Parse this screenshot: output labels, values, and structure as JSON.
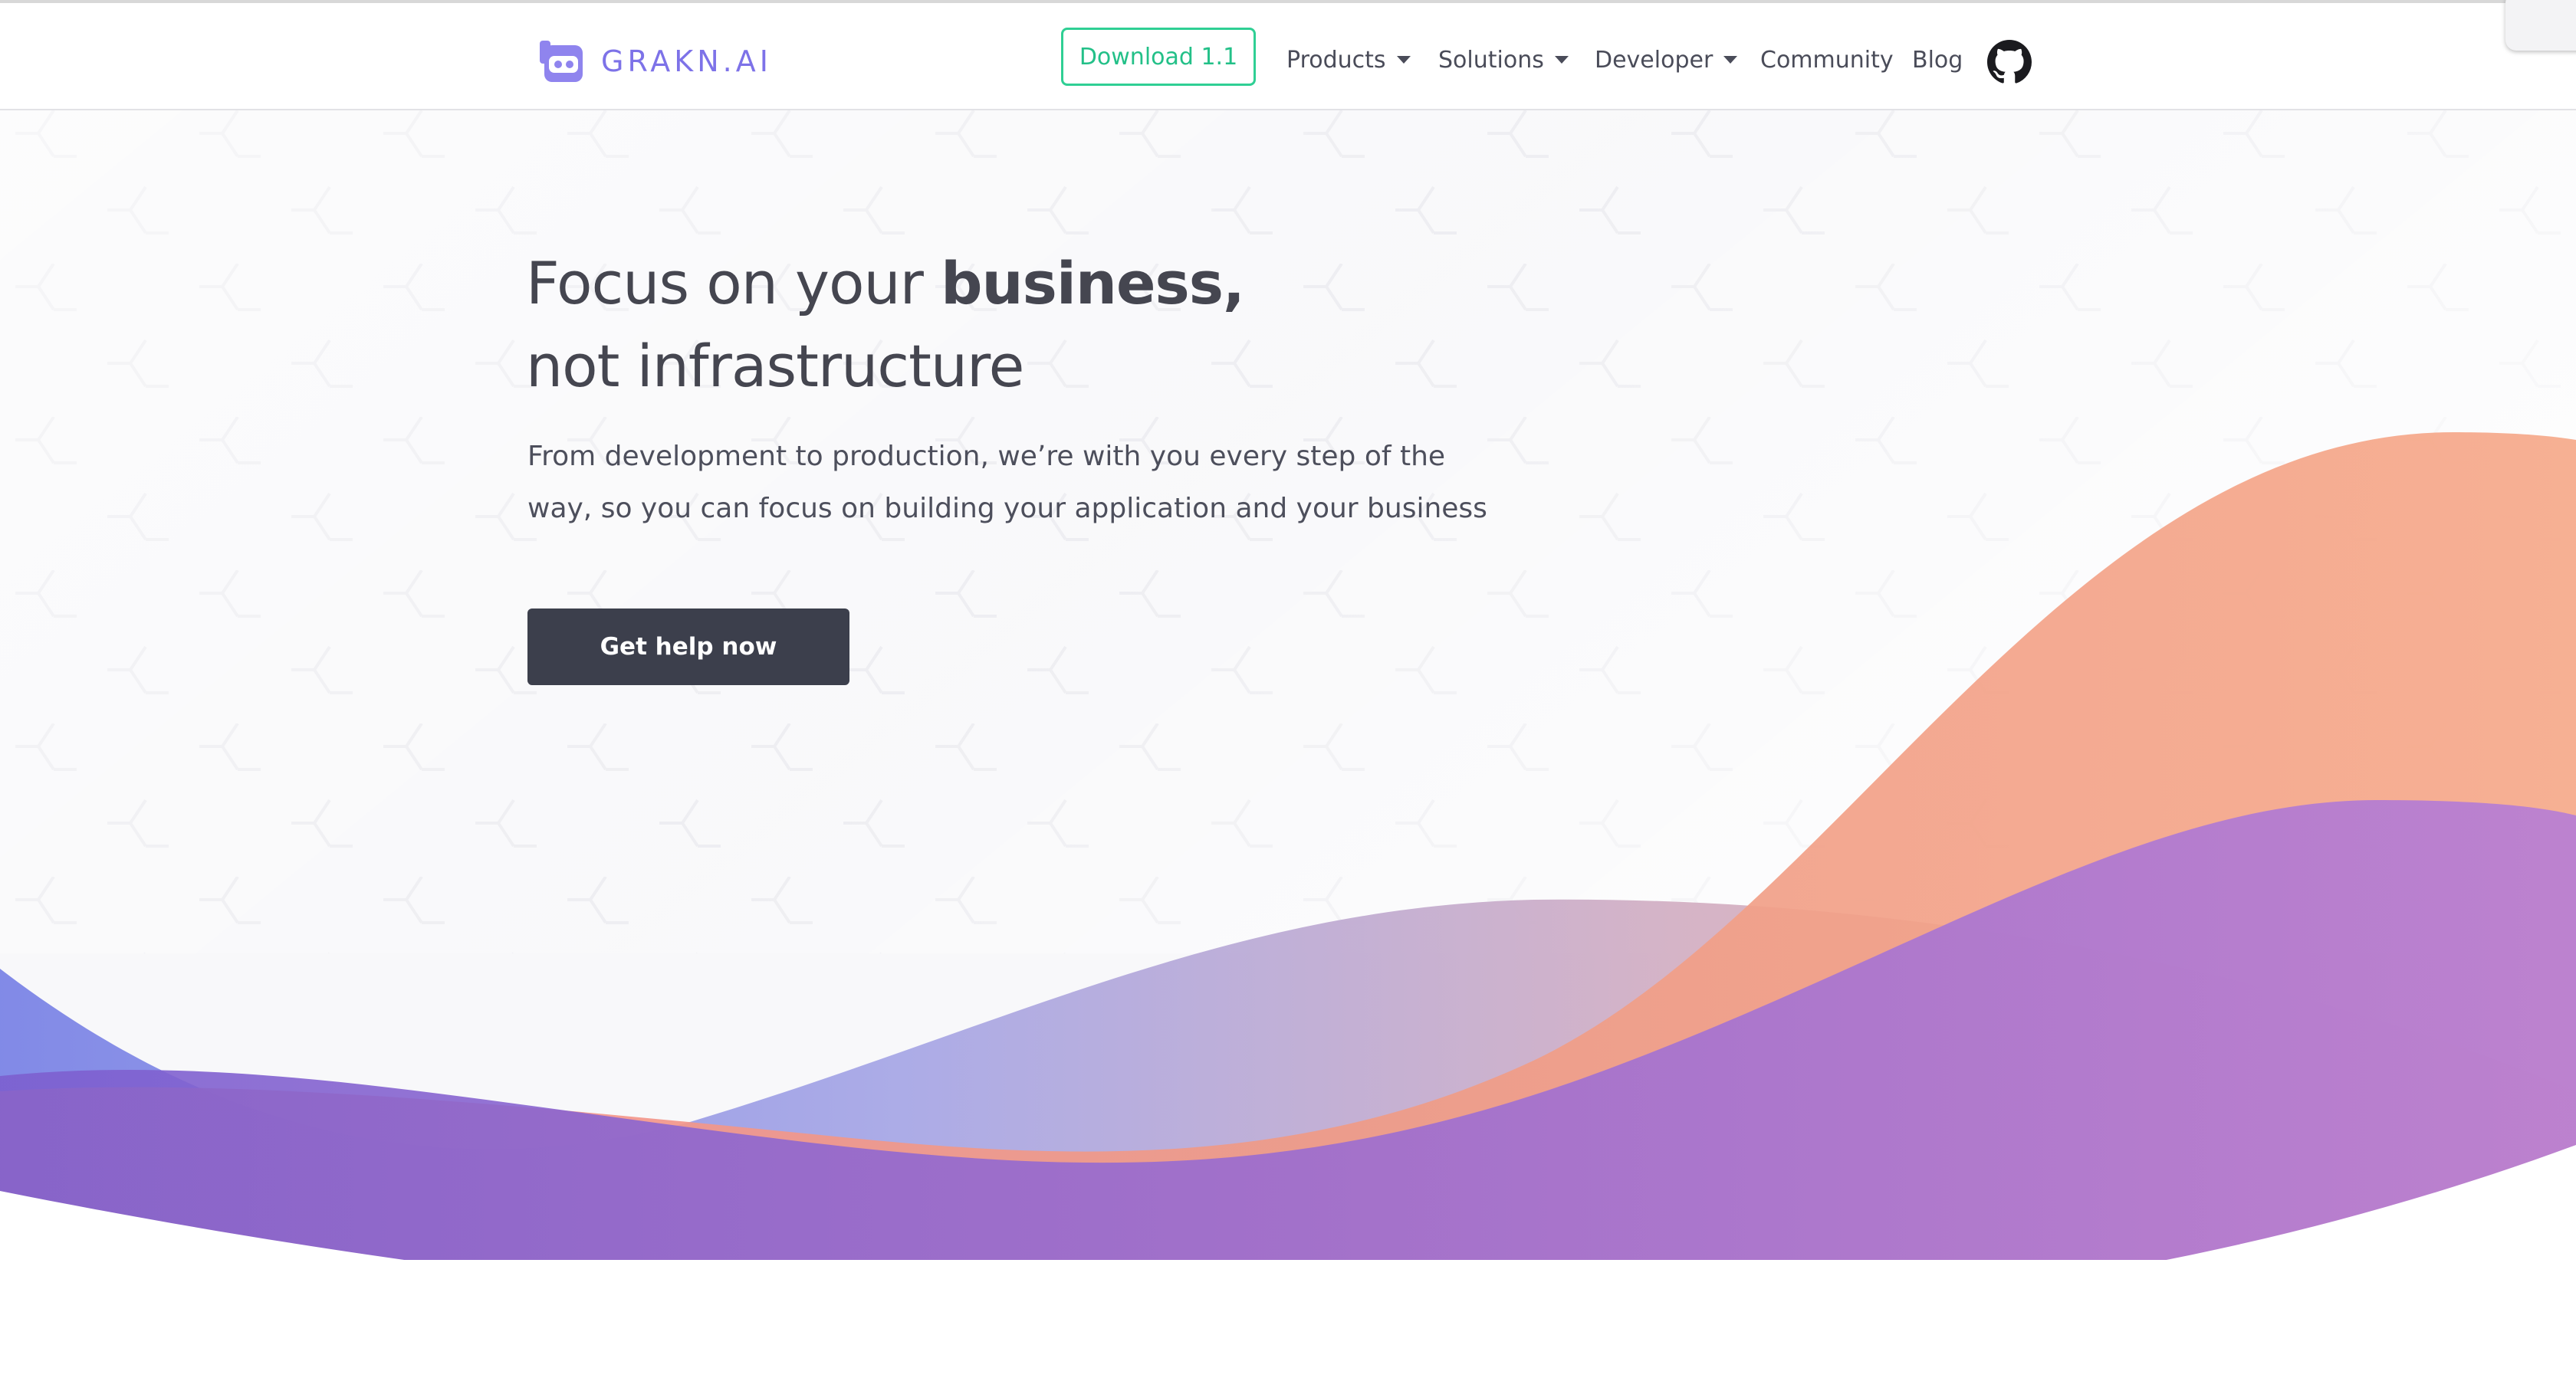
{
  "header": {
    "logo_text": "GRAKN.AI",
    "download_label": "Download 1.1",
    "nav": {
      "products": "Products",
      "solutions": "Solutions",
      "developer": "Developer",
      "community": "Community",
      "blog": "Blog"
    },
    "github_icon": "github-icon"
  },
  "hero": {
    "title_line1_regular": "Focus on your ",
    "title_line1_bold": "business,",
    "title_line2": "not infrastructure",
    "description_line1": "From development to production, we’re with you every step of the",
    "description_line2": "way, so you can focus on building your application and your business",
    "cta_label": "Get help now"
  },
  "colors": {
    "brand_purple": "#7d72e8",
    "download_green": "#23c088",
    "cta_dark": "#3c3f4c",
    "wave_orange": "#f4a582",
    "wave_purple": "#a371d6",
    "wave_blue": "#7f86e4"
  }
}
